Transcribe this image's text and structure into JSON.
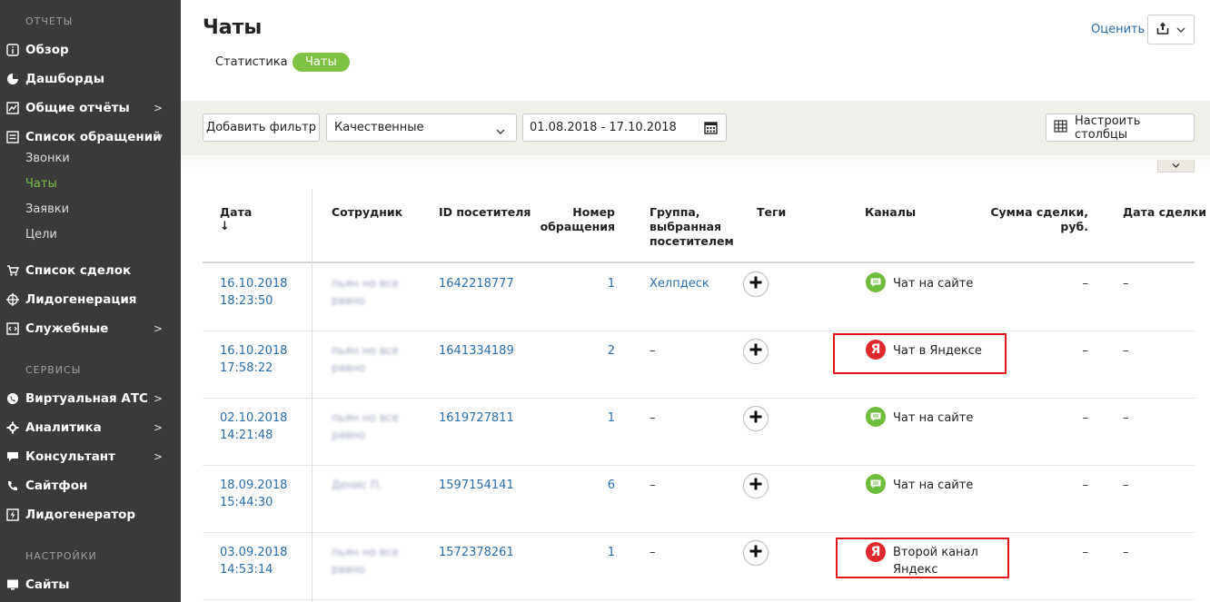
{
  "sidebar": {
    "sections": {
      "reports": "ОТЧЕТЫ",
      "services": "СЕРВИСЫ",
      "settings": "НАСТРОЙКИ"
    },
    "items": [
      {
        "label": "Обзор",
        "icon": "info-icon"
      },
      {
        "label": "Дашборды",
        "icon": "pie-chart-icon"
      },
      {
        "label": "Общие отчёты",
        "icon": "line-chart-icon",
        "arrow": ">"
      },
      {
        "label": "Список обращений",
        "icon": "list-icon",
        "arrow": "v"
      },
      {
        "label": "Список сделок",
        "icon": "cart-icon"
      },
      {
        "label": "Лидогенерация",
        "icon": "target-icon"
      },
      {
        "label": "Служебные",
        "icon": "code-icon",
        "arrow": ">"
      },
      {
        "label": "Виртуальная АТС",
        "icon": "phone-icon",
        "arrow": ">"
      },
      {
        "label": "Аналитика",
        "icon": "gear-icon",
        "arrow": ">"
      },
      {
        "label": "Консультант",
        "icon": "chat-icon",
        "arrow": ">"
      },
      {
        "label": "Сайтфон",
        "icon": "handset-icon"
      },
      {
        "label": "Лидогенератор",
        "icon": "lightning-icon"
      },
      {
        "label": "Сайты",
        "icon": "monitor-icon"
      }
    ],
    "subitems": [
      "Звонки",
      "Чаты",
      "Заявки",
      "Цели"
    ],
    "active_subitem": "Чаты"
  },
  "header": {
    "title": "Чаты",
    "tabs": [
      "Статистика",
      "Чаты"
    ],
    "active_tab": "Чаты",
    "rate_link": "Оценить"
  },
  "filters": {
    "add_filter": "Добавить фильтр",
    "quality_select": "Качественные",
    "date_range": "01.08.2018 - 17.10.2018",
    "configure_columns": "Настроить столбцы"
  },
  "table": {
    "columns": {
      "date": "Дата",
      "employee": "Сотрудник",
      "visitor_id": "ID посетителя",
      "number_l1": "Номер",
      "number_l2": "обращения",
      "group_l1": "Группа,",
      "group_l2": "выбранная",
      "group_l3": "посетителем",
      "tags": "Теги",
      "channels": "Каналы",
      "sum_l1": "Сумма сделки,",
      "sum_l2": "руб.",
      "deal_date": "Дата сделки"
    },
    "sort_indicator": "↓",
    "rows": [
      {
        "date": "16.10.2018",
        "time": "18:23:50",
        "employee_l1": "пьян но все",
        "employee_l2": "равно",
        "visitor_id": "1642218777",
        "number": "1",
        "group": "Хелпдеск",
        "channel_l1": "Чат на сайте",
        "channel_l2": "",
        "channel_type": "site",
        "sum": "–",
        "deal_date": "–"
      },
      {
        "date": "16.10.2018",
        "time": "17:58:22",
        "employee_l1": "пьян но все",
        "employee_l2": "равно",
        "visitor_id": "1641334189",
        "number": "2",
        "group": "–",
        "channel_l1": "Чат в Яндексе",
        "channel_l2": "",
        "channel_type": "yandex",
        "sum": "–",
        "deal_date": "–"
      },
      {
        "date": "02.10.2018",
        "time": "14:21:48",
        "employee_l1": "пьян но все",
        "employee_l2": "равно",
        "visitor_id": "1619727811",
        "number": "1",
        "group": "–",
        "channel_l1": "Чат на сайте",
        "channel_l2": "",
        "channel_type": "site",
        "sum": "–",
        "deal_date": "–"
      },
      {
        "date": "18.09.2018",
        "time": "15:44:30",
        "employee_l1": "Денис П.",
        "employee_l2": "",
        "visitor_id": "1597154141",
        "number": "6",
        "group": "–",
        "channel_l1": "Чат на сайте",
        "channel_l2": "",
        "channel_type": "site",
        "sum": "–",
        "deal_date": "–"
      },
      {
        "date": "03.09.2018",
        "time": "14:53:14",
        "employee_l1": "пьян но все",
        "employee_l2": "равно",
        "visitor_id": "1572378261",
        "number": "1",
        "group": "–",
        "channel_l1": "Второй канал",
        "channel_l2": "Яндекс",
        "channel_type": "yandex",
        "sum": "–",
        "deal_date": "–"
      }
    ]
  },
  "colors": {
    "accent_green": "#7dc243",
    "link_blue": "#2a6ea8",
    "highlight_red": "#e1161b",
    "sidebar_bg": "#3a3a3a"
  }
}
